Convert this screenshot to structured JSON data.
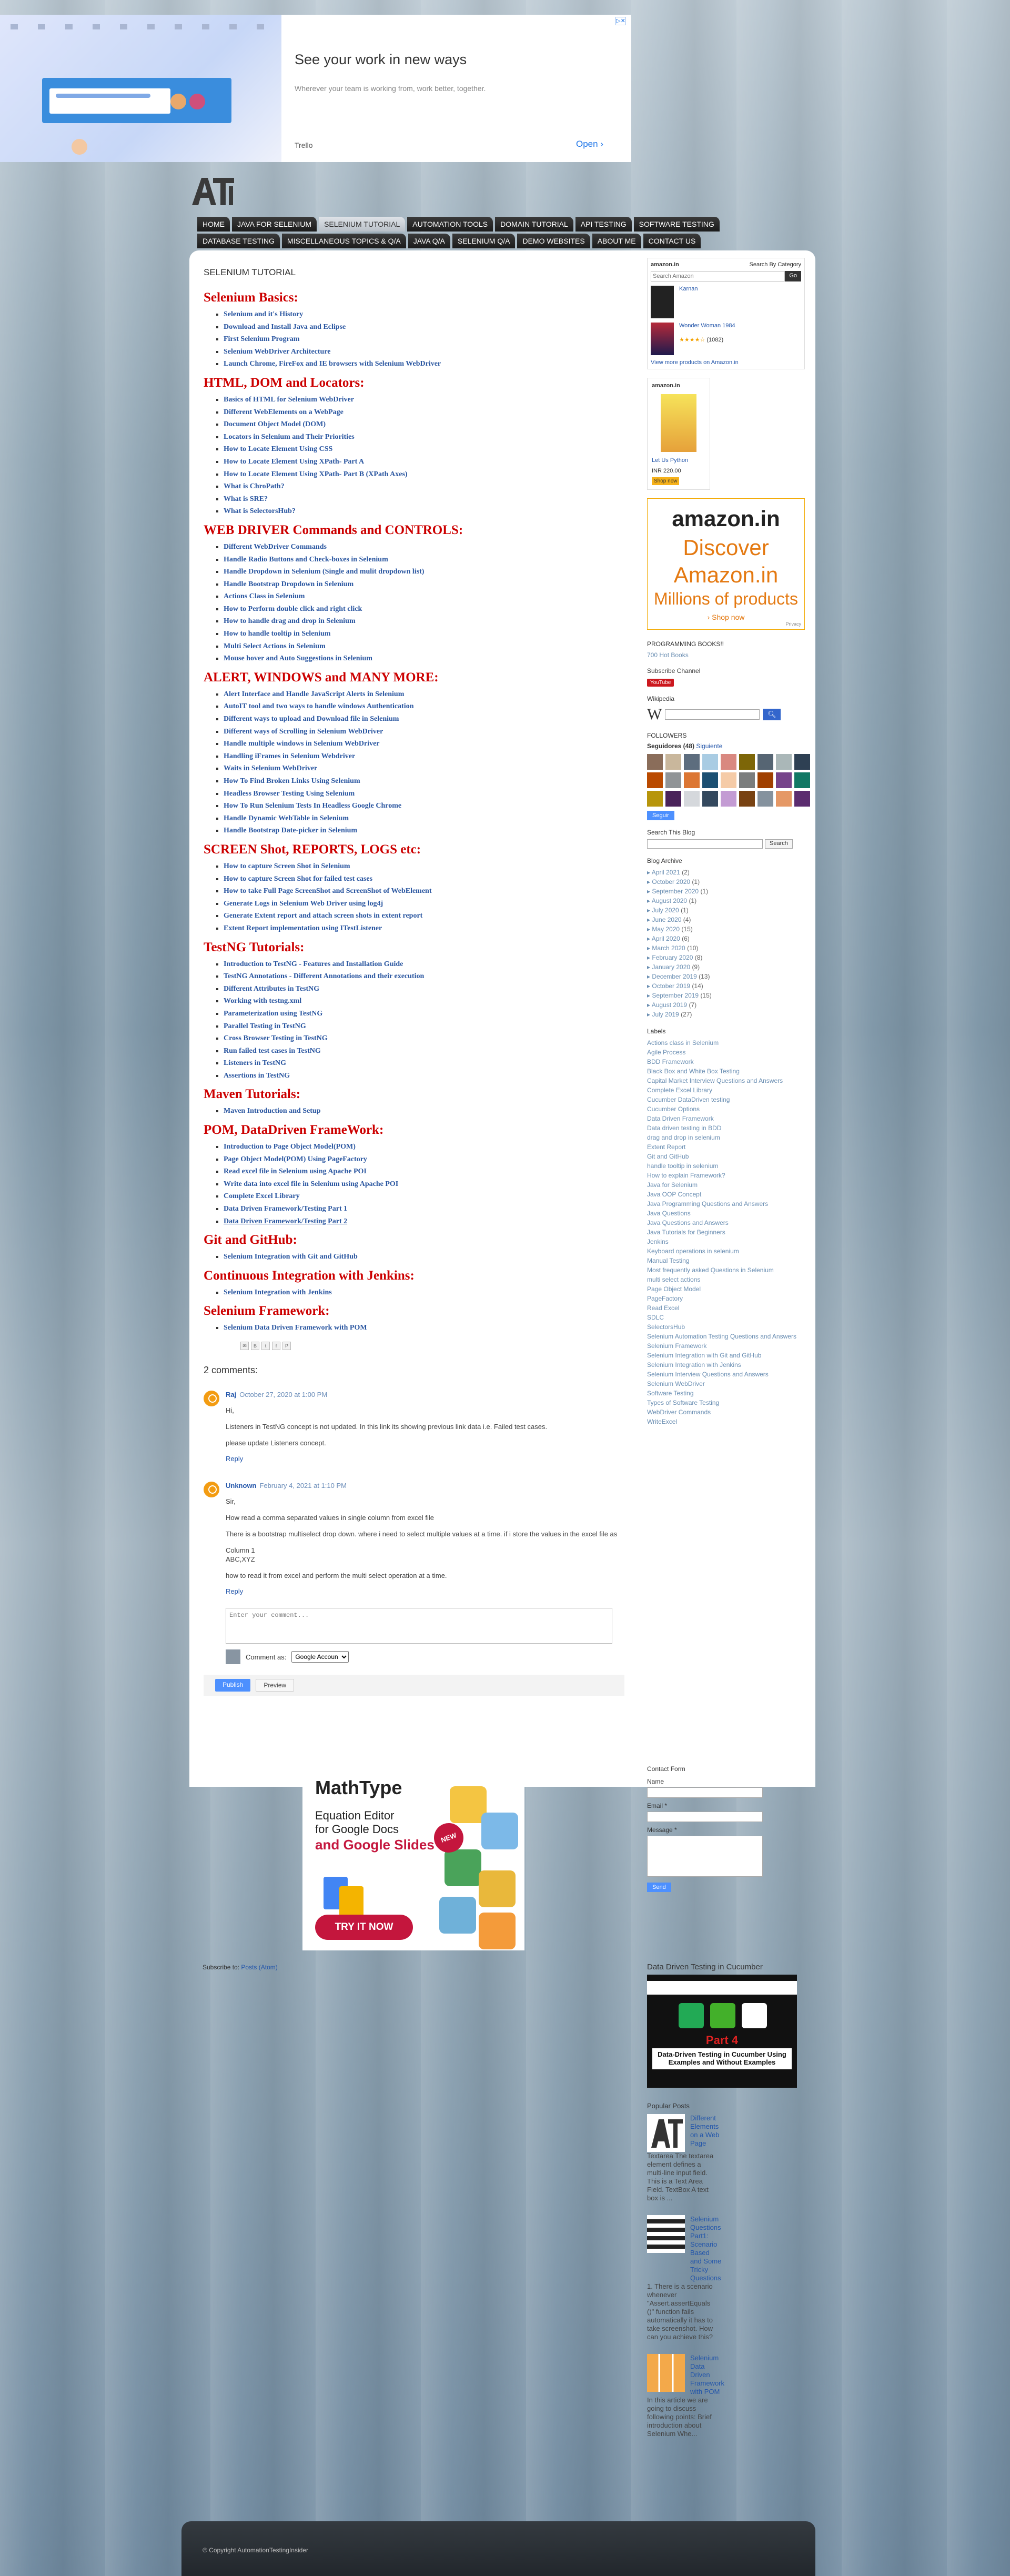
{
  "ad": {
    "title": "See your work in new ways",
    "subtitle": "Wherever your team is working from, work better, together.",
    "brand": "Trello",
    "open_label": "Open",
    "open_icon": "chevron-right-icon",
    "adchoices": "▷✕"
  },
  "nav": {
    "row1": [
      "HOME",
      "JAVA FOR SELENIUM",
      "SELENIUM TUTORIAL",
      "AUTOMATION TOOLS",
      "DOMAIN TUTORIAL",
      "API TESTING",
      "SOFTWARE TESTING"
    ],
    "row2": [
      "DATABASE TESTING",
      "MISCELLANEOUS TOPICS & Q/A",
      "JAVA Q/A",
      "SELENIUM Q/A",
      "DEMO WEBSITES",
      "ABOUT ME",
      "CONTACT US"
    ],
    "active": "SELENIUM TUTORIAL"
  },
  "post": {
    "label": "SELENIUM TUTORIAL",
    "sections": [
      {
        "title": "Selenium Basics:",
        "items": [
          "Selenium and it's History",
          "Download and Install Java and Eclipse",
          "First Selenium Program",
          "Selenium WebDriver Architecture",
          "Launch Chrome, FireFox and IE browsers with Selenium WebDriver"
        ]
      },
      {
        "title": "HTML, DOM and Locators:",
        "items": [
          "Basics of HTML for Selenium WebDriver",
          "Different WebElements on a WebPage",
          "Document Object Model (DOM)",
          "Locators in Selenium and Their Priorities",
          "How to Locate Element Using CSS",
          "How to Locate Element Using XPath- Part A",
          "How to Locate Element Using XPath- Part B (XPath Axes)",
          "What is ChroPath?",
          "What is SRE?",
          "What is SelectorsHub?"
        ]
      },
      {
        "title": "WEB DRIVER Commands and CONTROLS:",
        "items": [
          "Different WebDriver Commands",
          "Handle Radio Buttons and Check-boxes in Selenium",
          "Handle Dropdown in Selenium (Single and mulit dropdown list)",
          "Handle Bootstrap Dropdown in Selenium",
          "Actions Class in Selenium",
          "How to Perform double click and right click",
          "How to handle drag and drop in Selenium",
          "How to handle tooltip in Selenium",
          "Multi Select Actions in Selenium",
          "Mouse hover and Auto Suggestions in Selenium"
        ]
      },
      {
        "title": "ALERT, WINDOWS and MANY MORE:",
        "items": [
          "Alert Interface and Handle JavaScript Alerts in Selenium",
          "AutoIT tool and two ways to handle windows Authentication",
          "Different ways to upload and Download file in Selenium",
          "Different ways of Scrolling in Selenium WebDriver",
          "Handle multiple windows in Selenium WebDriver",
          "Handling iFrames in Selenium Webdriver",
          "Waits in Selenium WebDriver",
          "How To Find Broken Links Using Selenium",
          "Headless Browser Testing Using Selenium",
          "How To Run Selenium Tests In Headless Google Chrome",
          "Handle Dynamic WebTable in Selenium",
          "Handle Bootstrap Date-picker in Selenium"
        ]
      },
      {
        "title": "SCREEN Shot, REPORTS, LOGS etc:",
        "items": [
          "How to capture Screen Shot in Selenium",
          "How to capture Screen Shot for failed test cases",
          "How to take Full Page ScreenShot and ScreenShot of WebElement",
          "Generate Logs in Selenium Web Driver using log4j",
          "Generate Extent report and attach screen shots in extent report",
          "Extent Report implementation using ITestListener"
        ]
      },
      {
        "title": "TestNG Tutorials:",
        "items": [
          "Introduction to TestNG - Features and Installation Guide",
          "TestNG Annotations - Different Annotations and their execution",
          "Different Attributes in TestNG",
          "Working with testng.xml",
          "Parameterization using TestNG",
          "Parallel Testing in TestNG",
          "Cross Browser Testing in TestNG",
          "Run failed test cases in TestNG",
          "Listeners in TestNG",
          "Assertions in TestNG"
        ]
      },
      {
        "title": "Maven Tutorials:",
        "items": [
          "Maven Introduction and Setup"
        ]
      },
      {
        "title": "POM, DataDriven FrameWork:",
        "items": [
          "Introduction to Page Object Model(POM)",
          "Page Object Model(POM) Using PageFactory",
          "Read excel file in Selenium using Apache POI",
          "Write data into excel file in Selenium using Apache POI",
          "Complete Excel Library",
          "Data Driven Framework/Testing Part 1",
          "Data Driven Framework/Testing Part 2"
        ]
      },
      {
        "title": "Git and GitHub:",
        "items": [
          "Selenium Integration with Git and GitHub"
        ]
      },
      {
        "title": "Continuous Integration with Jenkins:",
        "items": [
          "Selenium Integration with Jenkins"
        ]
      },
      {
        "title": "Selenium Framework:",
        "items": [
          "Selenium Data Driven Framework with POM"
        ]
      }
    ]
  },
  "share_icons": [
    "email-icon",
    "blogthis-icon",
    "twitter-icon",
    "facebook-icon",
    "pinterest-icon"
  ],
  "comments": {
    "title": "2 comments:",
    "list": [
      {
        "author": "Raj",
        "date": "October 27, 2020 at 1:00 PM",
        "paragraphs": [
          "Hi,",
          "Listeners in TestNG concept is not updated. In this link its showing previous link data i.e. Failed test cases.",
          "please update Listeners concept."
        ],
        "reply": "Reply"
      },
      {
        "author": "Unknown",
        "date": "February 4, 2021 at 1:10 PM",
        "paragraphs": [
          "Sir,",
          "How read a comma separated values in single column from excel file",
          "There is a bootstrap multiselect drop down. where i need to select multiple values at a time. if i store the values in the excel file as",
          "Column 1\nABC,XYZ",
          "how to read it from excel and perform the multi select operation at a time."
        ],
        "reply": "Reply"
      }
    ],
    "placeholder": "Enter your comment...",
    "comment_as": "Comment as:",
    "account": "Google Accoun",
    "publish": "Publish",
    "preview": "Preview"
  },
  "sidebar": {
    "amazon_widget": {
      "brand": "amazon.in",
      "category": "Search By Category",
      "search_placeholder": "Search Amazon",
      "go": "Go",
      "products": [
        {
          "title": "Karnan",
          "rating": "",
          "count": ""
        },
        {
          "title": "Wonder Woman 1984",
          "rating": "★★★★☆",
          "count": "(1082)"
        }
      ],
      "view_more": "View more products on Amazon.in"
    },
    "amazon_book": {
      "brand": "amazon.in",
      "title": "Let Us Python",
      "price": "INR 220.00",
      "shop": "Shop now"
    },
    "amazon_banner": {
      "brand": "amazon.in",
      "line1": "Discover",
      "line2": "Amazon.in",
      "line3": "Millions of products",
      "shop": "› Shop now",
      "tag": "Privacy"
    },
    "programming_books": {
      "title": "PROGRAMMING BOOKS!!",
      "link": "700 Hot Books"
    },
    "subscribe_channel": {
      "title": "Subscribe Channel",
      "button": "YouTube"
    },
    "wikipedia": {
      "title": "Wikipedia",
      "logo": "W"
    },
    "followers": {
      "title": "FOLLOWERS",
      "count_text": "Seguidores (48)",
      "next": "Siguiente",
      "follow": "Seguir"
    },
    "search": {
      "title": "Search This Blog",
      "button": "Search"
    },
    "archive": {
      "title": "Blog Archive",
      "items": [
        {
          "month": "April 2021",
          "count": "(2)"
        },
        {
          "month": "October 2020",
          "count": "(1)"
        },
        {
          "month": "September 2020",
          "count": "(1)"
        },
        {
          "month": "August 2020",
          "count": "(1)"
        },
        {
          "month": "July 2020",
          "count": "(1)"
        },
        {
          "month": "June 2020",
          "count": "(4)"
        },
        {
          "month": "May 2020",
          "count": "(15)"
        },
        {
          "month": "April 2020",
          "count": "(6)"
        },
        {
          "month": "March 2020",
          "count": "(10)"
        },
        {
          "month": "February 2020",
          "count": "(8)"
        },
        {
          "month": "January 2020",
          "count": "(9)"
        },
        {
          "month": "December 2019",
          "count": "(13)"
        },
        {
          "month": "October 2019",
          "count": "(14)"
        },
        {
          "month": "September 2019",
          "count": "(15)"
        },
        {
          "month": "August 2019",
          "count": "(7)"
        },
        {
          "month": "July 2019",
          "count": "(27)"
        }
      ]
    },
    "labels": {
      "title": "Labels",
      "items": [
        "Actions class in Selenium",
        "Agile Process",
        "BDD Framework",
        "Black Box and White Box Testing",
        "Capital Market Interview Questions and Answers",
        "Complete Excel Library",
        "Cucumber DataDriven testing",
        "Cucumber Options",
        "Data Driven Framework",
        "Data driven testing in BDD",
        "drag and drop in selenium",
        "Extent Report",
        "Git and GitHub",
        "handle tooltip in selenium",
        "How to explain Framework?",
        "Java for Selenium",
        "Java OOP Concept",
        "Java Programming Questions and Answers",
        "Java Questions",
        "Java Questions and Answers",
        "Java Tutorials for Beginners",
        "Jenkins",
        "Keyboard operations in selenium",
        "Manual Testing",
        "Most frequently asked Questions in Selenium",
        "multi select actions",
        "Page Object Model",
        "PageFactory",
        "Read Excel",
        "SDLC",
        "SelectorsHub",
        "Selenium Automation Testing Questions and Answers",
        "Selenium Framework",
        "Selenium Integration with Git and GitHub",
        "Selenium Integration with Jenkins",
        "Selenium Interview Questions and Answers",
        "Selenium WebDriver",
        "Software Testing",
        "Types of Software Testing",
        "WebDriver Commands",
        "WriteExcel"
      ]
    }
  },
  "mathtype_ad": {
    "logo": "MathType",
    "line1": "Equation Editor",
    "line2": "for Google Docs",
    "line3a": "and Google Slides",
    "badge": "NEW",
    "button": "TRY IT NOW"
  },
  "contact": {
    "title": "Contact Form",
    "name": "Name",
    "email": "Email *",
    "message": "Message *",
    "send": "Send"
  },
  "subscribe": {
    "text": "Subscribe to:",
    "link": "Posts (Atom)"
  },
  "ddt": {
    "title": "Data Driven Testing in Cucumber",
    "part": "Part 4",
    "caption": "Data-Driven Testing in Cucumber Using Examples and Without Examples"
  },
  "popular": {
    "title": "Popular Posts",
    "posts": [
      {
        "title": "Different Elements on a Web Page",
        "desc": "Textarea The textarea element defines a multi-line input field. This is a Text Area Field. TextBox A text box is ..."
      },
      {
        "title": "Selenium Questions Part1: Scenario Based and Some Tricky Questions",
        "desc": "1. There is a scenario whenever \"Assert.assertEquals ()\" function fails automatically it has to take screenshot. How can you achieve this?"
      },
      {
        "title": "Selenium Data Driven Framework with POM",
        "desc": "In this article we are going to discuss following points: Brief introduction about Selenium Whe..."
      }
    ]
  },
  "footer": {
    "text": "© Copyright AutomationTestingInsider"
  }
}
